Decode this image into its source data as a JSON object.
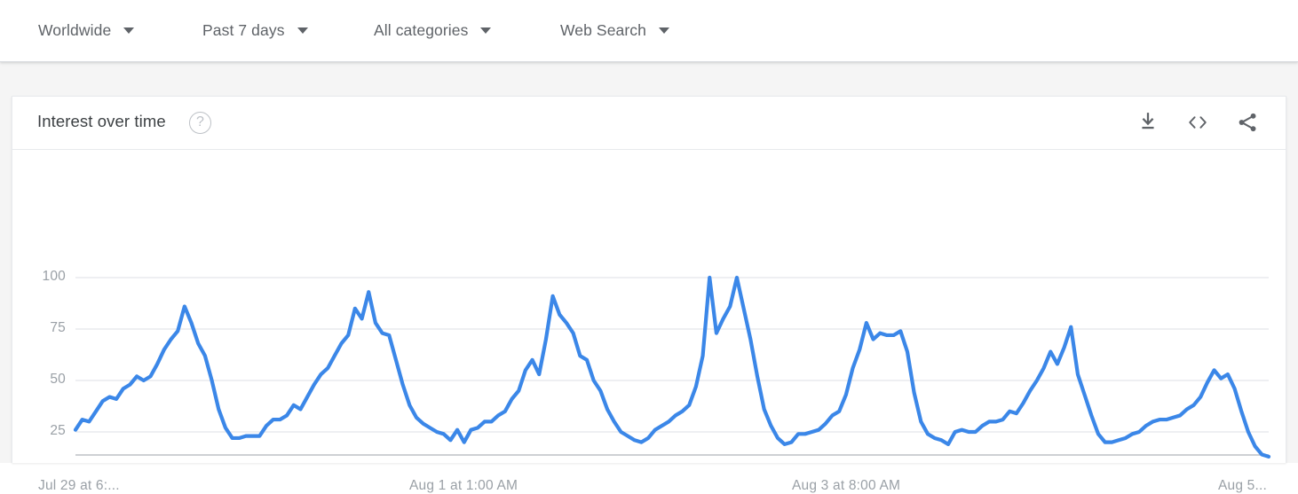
{
  "filters": [
    {
      "label": "Worldwide",
      "icon": "chevron-down-icon"
    },
    {
      "label": "Past 7 days",
      "icon": "chevron-down-icon"
    },
    {
      "label": "All categories",
      "icon": "chevron-down-icon"
    },
    {
      "label": "Web Search",
      "icon": "chevron-down-icon"
    }
  ],
  "card": {
    "title": "Interest over time",
    "help_label": "?",
    "actions": [
      {
        "name": "download-icon",
        "label": "Download CSV"
      },
      {
        "name": "embed-icon",
        "label": "Embed"
      },
      {
        "name": "share-icon",
        "label": "Share"
      }
    ]
  },
  "colors": {
    "line": "#3b87e8",
    "grid": "#e8eaed",
    "axis": "#9aa0a6",
    "text": "#5f6368",
    "title": "#3c4043",
    "page_bg": "#f5f5f5",
    "card_bg": "#ffffff"
  },
  "chart_data": {
    "type": "line",
    "title": "Interest over time",
    "xlabel": "",
    "ylabel": "",
    "ylim": [
      0,
      105
    ],
    "yticks": [
      25,
      50,
      75,
      100
    ],
    "ytick_labels": [
      "25",
      "50",
      "75",
      "100"
    ],
    "grid": true,
    "legend": false,
    "xtick_labels": [
      "Jul 29 at 6:...",
      "Aug 1 at 1:00 AM",
      "Aug 3 at 8:00 AM",
      "Aug 5..."
    ],
    "xtick_positions": [
      0,
      0.317,
      0.645,
      0.995
    ],
    "series": [
      {
        "name": "Interest",
        "color": "#3b87e8",
        "values": [
          26,
          31,
          30,
          35,
          40,
          42,
          41,
          46,
          48,
          52,
          50,
          52,
          58,
          65,
          70,
          74,
          86,
          78,
          68,
          62,
          50,
          36,
          27,
          22,
          22,
          23,
          23,
          23,
          28,
          31,
          31,
          33,
          38,
          36,
          42,
          48,
          53,
          56,
          62,
          68,
          72,
          85,
          80,
          93,
          78,
          73,
          72,
          60,
          48,
          38,
          32,
          29,
          27,
          25,
          24,
          21,
          26,
          20,
          26,
          27,
          30,
          30,
          33,
          35,
          41,
          45,
          55,
          60,
          53,
          70,
          91,
          82,
          78,
          73,
          62,
          60,
          50,
          45,
          36,
          30,
          25,
          23,
          21,
          20,
          22,
          26,
          28,
          30,
          33,
          35,
          38,
          47,
          62,
          100,
          73,
          80,
          86,
          100,
          85,
          70,
          52,
          36,
          28,
          22,
          19,
          20,
          24,
          24,
          25,
          26,
          29,
          33,
          35,
          43,
          56,
          65,
          78,
          70,
          73,
          72,
          72,
          74,
          64,
          44,
          30,
          24,
          22,
          21,
          19,
          25,
          26,
          25,
          25,
          28,
          30,
          30,
          31,
          35,
          34,
          39,
          45,
          50,
          56,
          64,
          58,
          66,
          76,
          53,
          43,
          33,
          24,
          20,
          20,
          21,
          22,
          24,
          25,
          28,
          30,
          31,
          31,
          32,
          33,
          36,
          38,
          42,
          49,
          55,
          51,
          53,
          46,
          35,
          25,
          18,
          14,
          13
        ]
      }
    ]
  }
}
